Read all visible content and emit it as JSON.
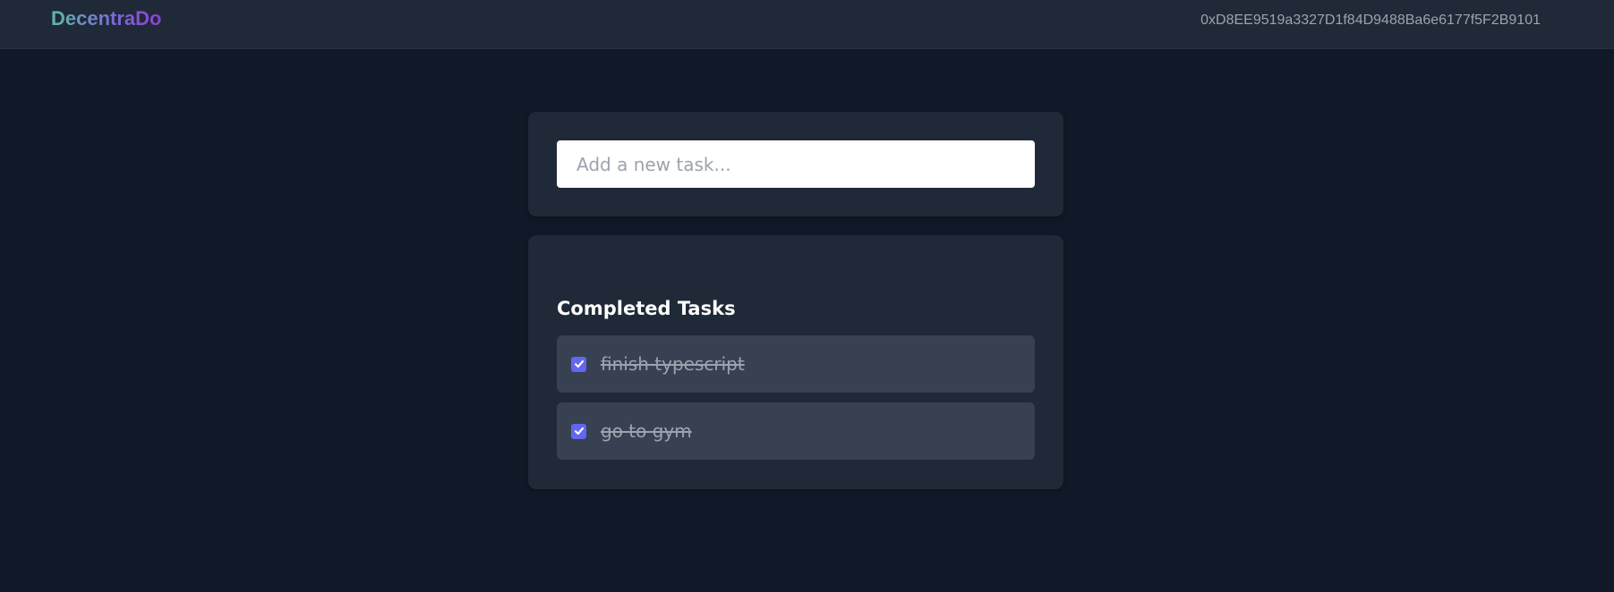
{
  "header": {
    "brand": "DecentraDo",
    "wallet_address": "0xD8EE9519a3327D1f84D9488Ba6e6177f5F2B9101"
  },
  "new_task": {
    "placeholder": "Add a new task...",
    "value": ""
  },
  "completed": {
    "title": "Completed Tasks",
    "tasks": [
      {
        "text": "finish typescript",
        "checked": true
      },
      {
        "text": "go to gym",
        "checked": true
      }
    ]
  },
  "colors": {
    "background": "#111827",
    "card": "#1f2937",
    "task_item": "#374151",
    "accent": "#6366f1",
    "muted_text": "#9ca3af",
    "brand_gradient_start": "#5eb8a8",
    "brand_gradient_end": "#8b3fd1"
  },
  "icons": {
    "checkbox": "checkmark-icon"
  }
}
